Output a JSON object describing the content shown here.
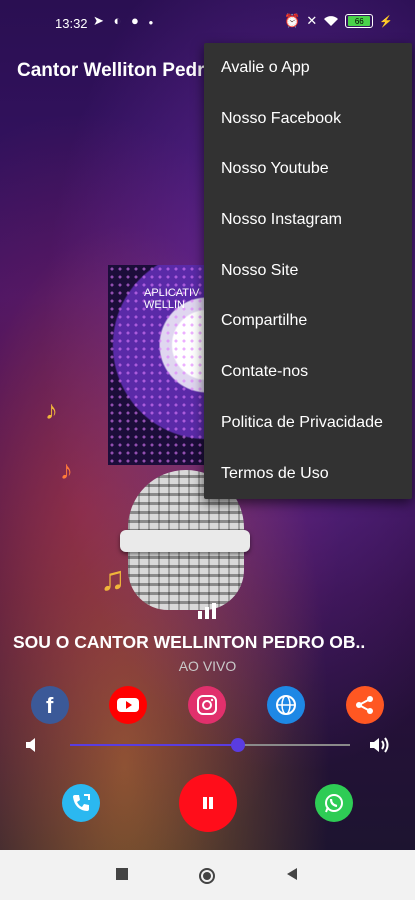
{
  "status_bar": {
    "time": "13:32",
    "left_icons": [
      "telegram-icon",
      "app-icon",
      "circle-icon",
      "dot-icon"
    ],
    "right_icons": [
      "alarm-off-icon",
      "mute-icon",
      "wifi-icon"
    ],
    "battery": "66",
    "charging": true
  },
  "app_bar": {
    "title": "Cantor Welliton Pedro"
  },
  "album_art": {
    "text_line1": "APLICATIV",
    "text_line2": "WELLIN"
  },
  "player": {
    "song_title": "SOU O CANTOR WELLINTON PEDRO OB..",
    "status": "AO VIVO",
    "volume_level": 0.6
  },
  "social_buttons": [
    {
      "name": "facebook",
      "color": "#3b5998"
    },
    {
      "name": "youtube",
      "color": "#ff0000"
    },
    {
      "name": "instagram",
      "color": "#e1306c"
    },
    {
      "name": "website",
      "color": "#1e88e5"
    },
    {
      "name": "share",
      "color": "#ff5722"
    }
  ],
  "menu": {
    "items": [
      "Avalie o App",
      "Nosso Facebook",
      "Nosso Youtube",
      "Nosso Instagram",
      "Nosso Site",
      "Compartilhe",
      "Contate-nos",
      "Politica de Privacidade",
      "Termos de Uso"
    ]
  },
  "colors": {
    "accent": "#5a3ce0",
    "pause_button": "#ff0d1a",
    "whatsapp": "#2ecc55",
    "phone": "#2bb8f0",
    "menu_background": "#323232"
  }
}
